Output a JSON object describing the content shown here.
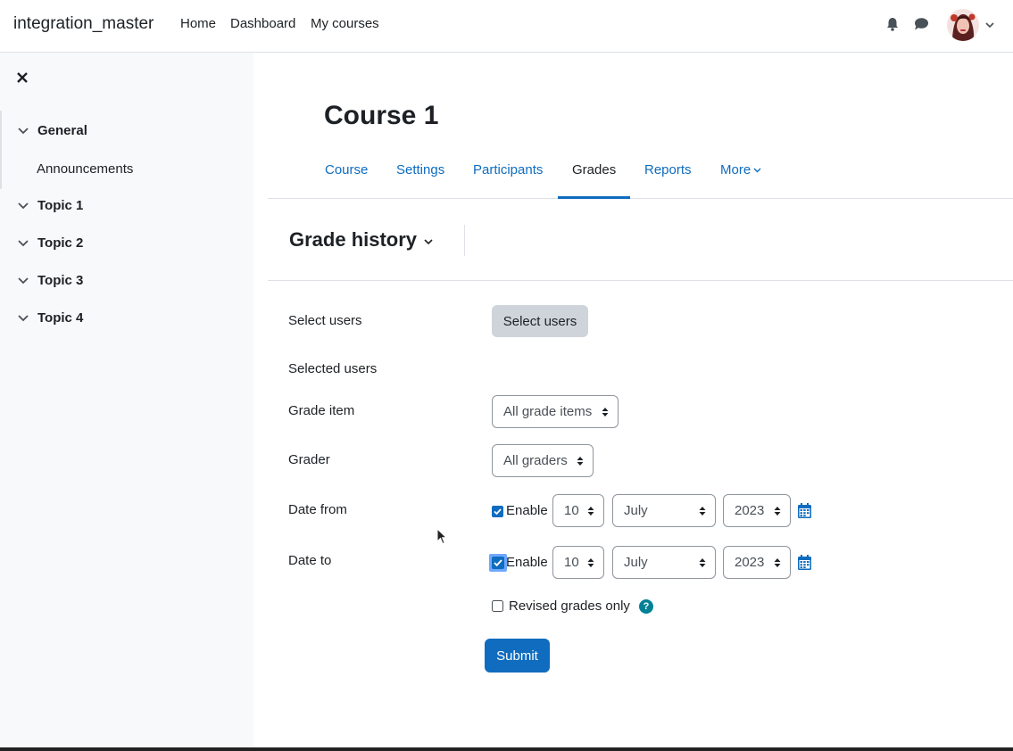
{
  "navbar": {
    "site_name": "integration_master",
    "links": [
      "Home",
      "Dashboard",
      "My courses"
    ],
    "icons": [
      "bell-icon",
      "chat-icon"
    ],
    "user_menu": "avatar"
  },
  "drawer": {
    "close_icon": "close-icon",
    "sections": [
      {
        "label": "General",
        "items": [
          "Announcements"
        ]
      },
      {
        "label": "Topic 1"
      },
      {
        "label": "Topic 2"
      },
      {
        "label": "Topic 3"
      },
      {
        "label": "Topic 4"
      }
    ]
  },
  "course": {
    "title": "Course 1",
    "tabs": [
      "Course",
      "Settings",
      "Participants",
      "Grades",
      "Reports",
      "More"
    ],
    "active_tab": "Grades"
  },
  "report": {
    "title": "Grade history"
  },
  "form": {
    "select_users": {
      "label": "Select users",
      "button": "Select users"
    },
    "selected_users": {
      "label": "Selected users"
    },
    "grade_item": {
      "label": "Grade item",
      "value": "All grade items"
    },
    "grader": {
      "label": "Grader",
      "value": "All graders"
    },
    "date_from": {
      "label": "Date from",
      "enable_label": "Enable",
      "enabled": true,
      "day": "10",
      "month": "July",
      "year": "2023"
    },
    "date_to": {
      "label": "Date to",
      "enable_label": "Enable",
      "enabled": true,
      "day": "10",
      "month": "July",
      "year": "2023"
    },
    "revised_only": {
      "label": "Revised grades only",
      "checked": false,
      "help": "?"
    },
    "submit": "Submit"
  },
  "colors": {
    "link": "#0f6cbf",
    "primary": "#0f6cbf",
    "help": "#008196",
    "drawer_bg": "#f8f9fa"
  }
}
